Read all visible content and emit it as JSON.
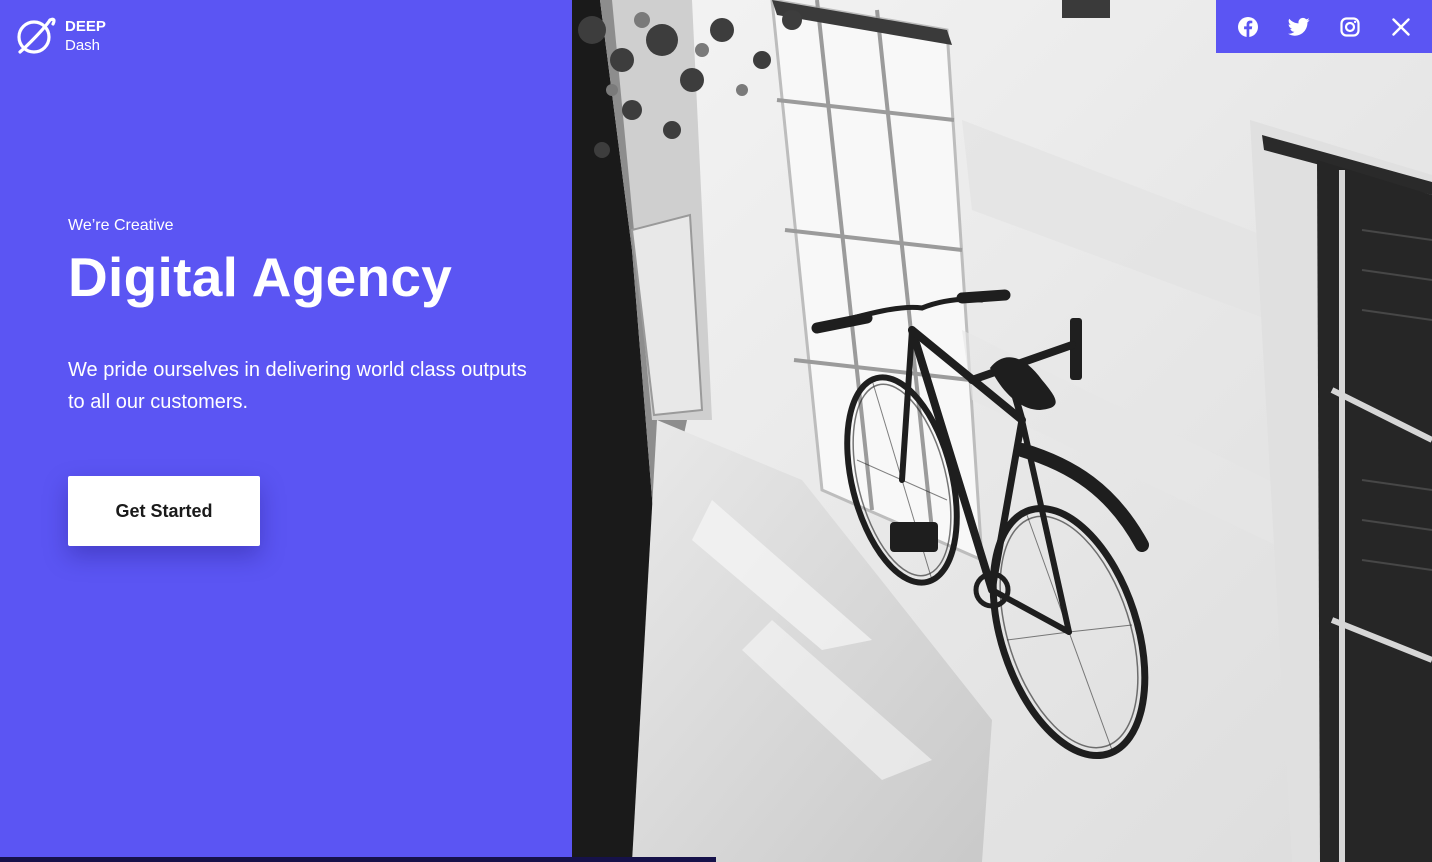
{
  "brand": {
    "name_line1": "DEEP",
    "name_line2": "Dash",
    "icon": "planet-logo-icon"
  },
  "hero": {
    "eyebrow": "We’re Creative",
    "headline": "Digital Agency",
    "description": "We pride ourselves in delivering world class outputs to all our customers.",
    "cta_label": "Get Started"
  },
  "social": {
    "icons": [
      "facebook-icon",
      "twitter-icon",
      "instagram-icon",
      "close-icon"
    ]
  },
  "progress": {
    "fraction": 0.5
  },
  "colors": {
    "accent": "#5b55f3",
    "progress": "#16124a",
    "button_bg": "#ffffff",
    "button_text": "#1a1a1a"
  }
}
